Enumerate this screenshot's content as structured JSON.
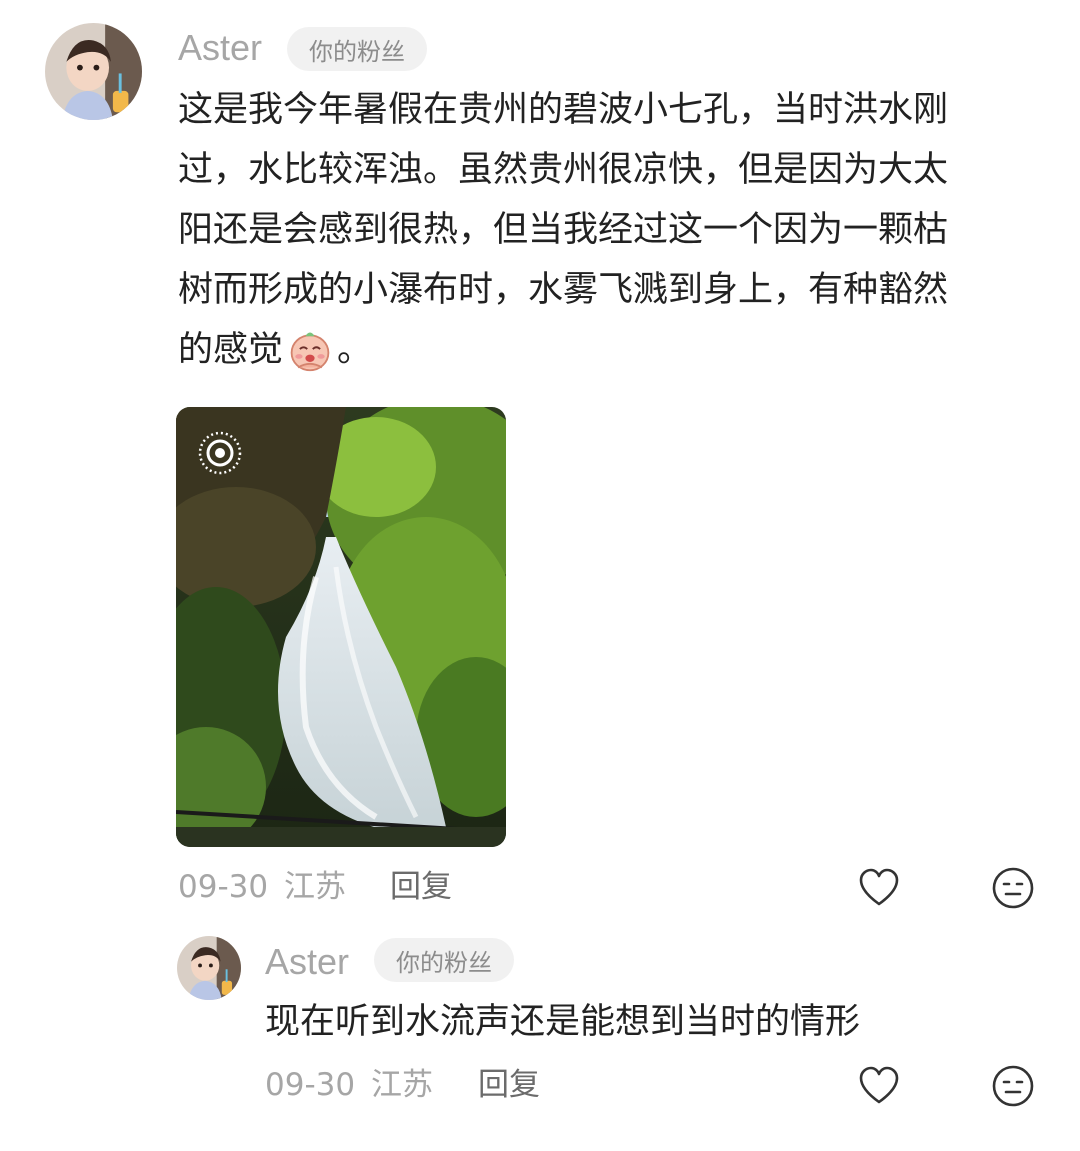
{
  "comment": {
    "username": "Aster",
    "badge": "你的粉丝",
    "lines": [
      "这是我今年暑假在贵州的碧波小七孔，当时洪水刚",
      "过，水比较浑浊。虽然贵州很凉快，但是因为大太",
      "阳还是会感到很热，但当我经过这一个因为一颗枯",
      "树而形成的小瀑布时，水雾飞溅到身上，有种豁然"
    ],
    "last_line_prefix": "的感觉",
    "last_line_suffix": "。",
    "date": "09-30",
    "location": "江苏",
    "reply_label": "回复"
  },
  "reply": {
    "username": "Aster",
    "badge": "你的粉丝",
    "text": "现在听到水流声还是能想到当时的情形",
    "date": "09-30",
    "location": "江苏",
    "reply_label": "回复"
  },
  "icons": {
    "like": "heart-outline-icon",
    "dislike": "neutral-face-icon",
    "live_photo": "live-photo-icon",
    "emoji": "pleading-emoji-icon"
  }
}
